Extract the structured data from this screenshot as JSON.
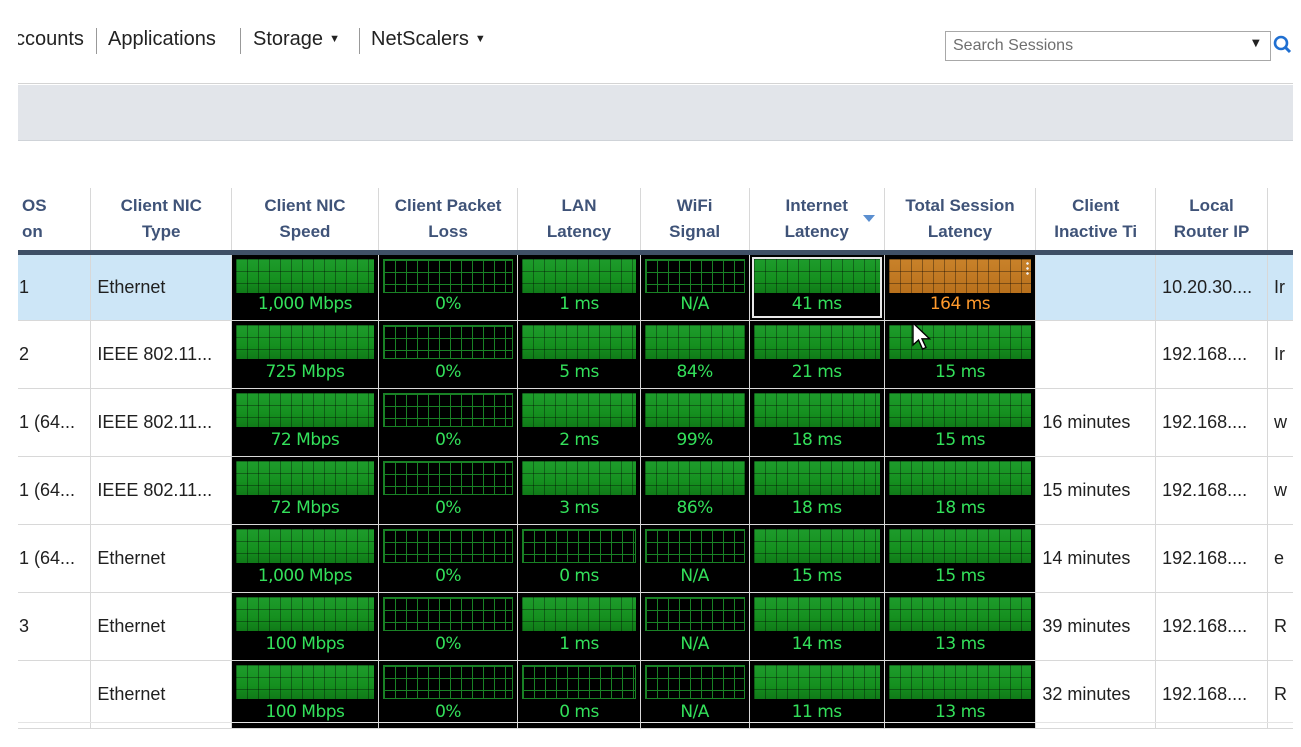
{
  "nav": {
    "items": [
      {
        "label": "ccounts",
        "has_caret": false
      },
      {
        "label": "Applications",
        "has_caret": false
      },
      {
        "label": "Storage",
        "has_caret": true
      },
      {
        "label": "NetScalers",
        "has_caret": true
      }
    ],
    "search_placeholder": "Search Sessions",
    "search_icon": "search-icon",
    "dropdown_icon": "caret-down-icon"
  },
  "table": {
    "columns": [
      {
        "key": "os",
        "label_line1": "OS",
        "label_line2": "on",
        "sorted": false
      },
      {
        "key": "nic_type",
        "label_line1": "Client NIC",
        "label_line2": "Type",
        "sorted": false
      },
      {
        "key": "nic_speed",
        "label_line1": "Client NIC",
        "label_line2": "Speed",
        "sorted": false
      },
      {
        "key": "packet_loss",
        "label_line1": "Client Packet",
        "label_line2": "Loss",
        "sorted": false
      },
      {
        "key": "lan_latency",
        "label_line1": "LAN",
        "label_line2": "Latency",
        "sorted": false
      },
      {
        "key": "wifi",
        "label_line1": "WiFi",
        "label_line2": "Signal",
        "sorted": false
      },
      {
        "key": "internet_latency",
        "label_line1": "Internet",
        "label_line2": "Latency",
        "sorted": true
      },
      {
        "key": "total_latency",
        "label_line1": "Total Session",
        "label_line2": "Latency",
        "sorted": false
      },
      {
        "key": "inactive",
        "label_line1": "Client",
        "label_line2": "Inactive Ti",
        "sorted": false
      },
      {
        "key": "router_ip",
        "label_line1": "Local",
        "label_line2": "Router IP",
        "sorted": false
      },
      {
        "key": "extra",
        "label_line1": "",
        "label_line2": "",
        "sorted": false
      }
    ],
    "rows": [
      {
        "selected": true,
        "os": "1",
        "nic_type": "Ethernet",
        "nic_speed": {
          "text": "1,000 Mbps",
          "fill": 1.0
        },
        "packet_loss": {
          "text": "0%",
          "fill": 0
        },
        "lan_latency": {
          "text": "1 ms",
          "fill": 1.0
        },
        "wifi": {
          "text": "N/A",
          "fill": 0
        },
        "internet_latency": {
          "text": "41 ms",
          "fill": 1.0,
          "highlight": true
        },
        "total_latency": {
          "text": "164 ms",
          "fill": 1.0,
          "status": "warning"
        },
        "inactive": "",
        "router_ip": "10.20.30....",
        "extra": "Ir"
      },
      {
        "selected": false,
        "os": "2",
        "nic_type": "IEEE 802.11...",
        "nic_speed": {
          "text": "725 Mbps",
          "fill": 1.0
        },
        "packet_loss": {
          "text": "0%",
          "fill": 0
        },
        "lan_latency": {
          "text": "5 ms",
          "fill": 1.0
        },
        "wifi": {
          "text": "84%",
          "fill": 1.0
        },
        "internet_latency": {
          "text": "21 ms",
          "fill": 1.0
        },
        "total_latency": {
          "text": "15 ms",
          "fill": 1.0
        },
        "inactive": "",
        "router_ip": "192.168....",
        "extra": "Ir"
      },
      {
        "selected": false,
        "os": "1 (64...",
        "nic_type": "IEEE 802.11...",
        "nic_speed": {
          "text": "72 Mbps",
          "fill": 1.0
        },
        "packet_loss": {
          "text": "0%",
          "fill": 0
        },
        "lan_latency": {
          "text": "2 ms",
          "fill": 1.0
        },
        "wifi": {
          "text": "99%",
          "fill": 1.0
        },
        "internet_latency": {
          "text": "18 ms",
          "fill": 1.0
        },
        "total_latency": {
          "text": "15 ms",
          "fill": 1.0
        },
        "inactive": "16 minutes",
        "router_ip": "192.168....",
        "extra": "w"
      },
      {
        "selected": false,
        "os": "1 (64...",
        "nic_type": "IEEE 802.11...",
        "nic_speed": {
          "text": "72 Mbps",
          "fill": 1.0
        },
        "packet_loss": {
          "text": "0%",
          "fill": 0
        },
        "lan_latency": {
          "text": "3 ms",
          "fill": 1.0
        },
        "wifi": {
          "text": "86%",
          "fill": 1.0
        },
        "internet_latency": {
          "text": "18 ms",
          "fill": 1.0
        },
        "total_latency": {
          "text": "18 ms",
          "fill": 1.0
        },
        "inactive": "15 minutes",
        "router_ip": "192.168....",
        "extra": "w"
      },
      {
        "selected": false,
        "os": "1 (64...",
        "nic_type": "Ethernet",
        "nic_speed": {
          "text": "1,000 Mbps",
          "fill": 1.0
        },
        "packet_loss": {
          "text": "0%",
          "fill": 0
        },
        "lan_latency": {
          "text": "0 ms",
          "fill": 0
        },
        "wifi": {
          "text": "N/A",
          "fill": 0
        },
        "internet_latency": {
          "text": "15 ms",
          "fill": 1.0
        },
        "total_latency": {
          "text": "15 ms",
          "fill": 1.0
        },
        "inactive": "14 minutes",
        "router_ip": "192.168....",
        "extra": "e"
      },
      {
        "selected": false,
        "os": "3",
        "nic_type": "Ethernet",
        "nic_speed": {
          "text": "100 Mbps",
          "fill": 1.0
        },
        "packet_loss": {
          "text": "0%",
          "fill": 0
        },
        "lan_latency": {
          "text": "1 ms",
          "fill": 1.0
        },
        "wifi": {
          "text": "N/A",
          "fill": 0
        },
        "internet_latency": {
          "text": "14 ms",
          "fill": 1.0
        },
        "total_latency": {
          "text": "13 ms",
          "fill": 1.0
        },
        "inactive": "39 minutes",
        "router_ip": "192.168....",
        "extra": "R"
      },
      {
        "selected": false,
        "os": "",
        "nic_type": "Ethernet",
        "nic_speed": {
          "text": "100 Mbps",
          "fill": 1.0
        },
        "packet_loss": {
          "text": "0%",
          "fill": 0
        },
        "lan_latency": {
          "text": "0 ms",
          "fill": 0
        },
        "wifi": {
          "text": "N/A",
          "fill": 0
        },
        "internet_latency": {
          "text": "11 ms",
          "fill": 1.0
        },
        "total_latency": {
          "text": "13 ms",
          "fill": 1.0
        },
        "inactive": "32 minutes",
        "router_ip": "192.168....",
        "extra": "R"
      }
    ]
  },
  "colors": {
    "metric_green": "#33e05a",
    "metric_warning": "#ff9a2c",
    "selected_row": "#cde6f7",
    "header_text": "#3f5378"
  }
}
